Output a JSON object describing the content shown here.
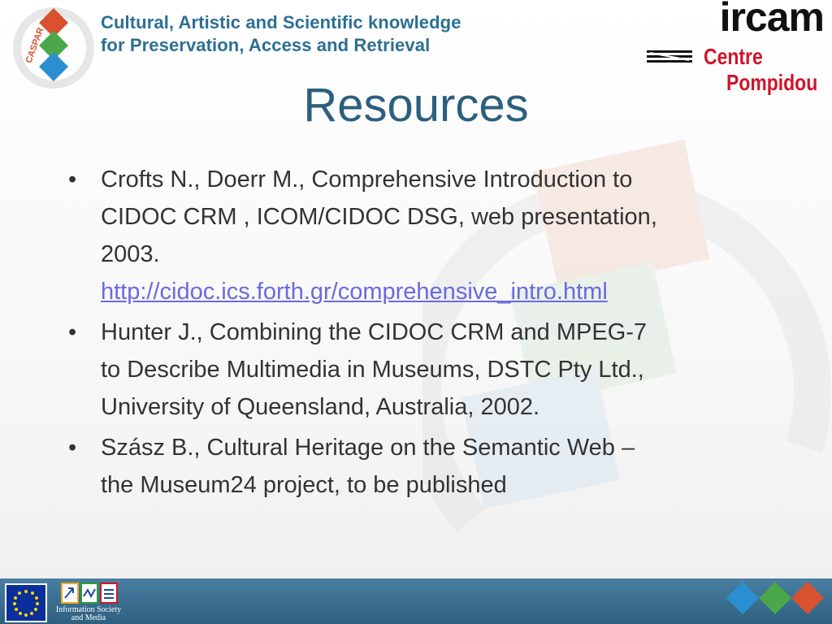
{
  "header": {
    "logo_text": "CASPAR",
    "tagline_line1": "Cultural, Artistic and Scientific knowledge",
    "tagline_line2": "for Preservation, Access and Retrieval",
    "ircam_text": "ircam",
    "centre_text": "Centre",
    "pompidou_text": "Pompidou"
  },
  "slide": {
    "title": "Resources",
    "bullets": [
      {
        "line1": "Crofts N., Doerr M., Comprehensive Introduction to",
        "line2": "CIDOC CRM , ICOM/CIDOC DSG, web presentation,",
        "line3": "2003.",
        "link": "http://cidoc.ics.forth.gr/comprehensive_intro.html"
      },
      {
        "line1": "Hunter J., Combining the CIDOC CRM and MPEG-7",
        "line2": "to Describe Multimedia in Museums, DSTC Pty Ltd.,",
        "line3": "University of Queensland, Australia, 2002."
      },
      {
        "line1": "Szász B., Cultural Heritage on the Semantic Web –",
        "line2": "the Museum24 project, to be published"
      }
    ]
  },
  "footer": {
    "ism_line1": "Information Society",
    "ism_line2": "and Media"
  },
  "colors": {
    "title": "#2c5f7f",
    "tagline": "#2c6f93",
    "centre_red": "#d0142a",
    "footer_bar": "#2d5f80",
    "link": "#6a6ae0"
  }
}
